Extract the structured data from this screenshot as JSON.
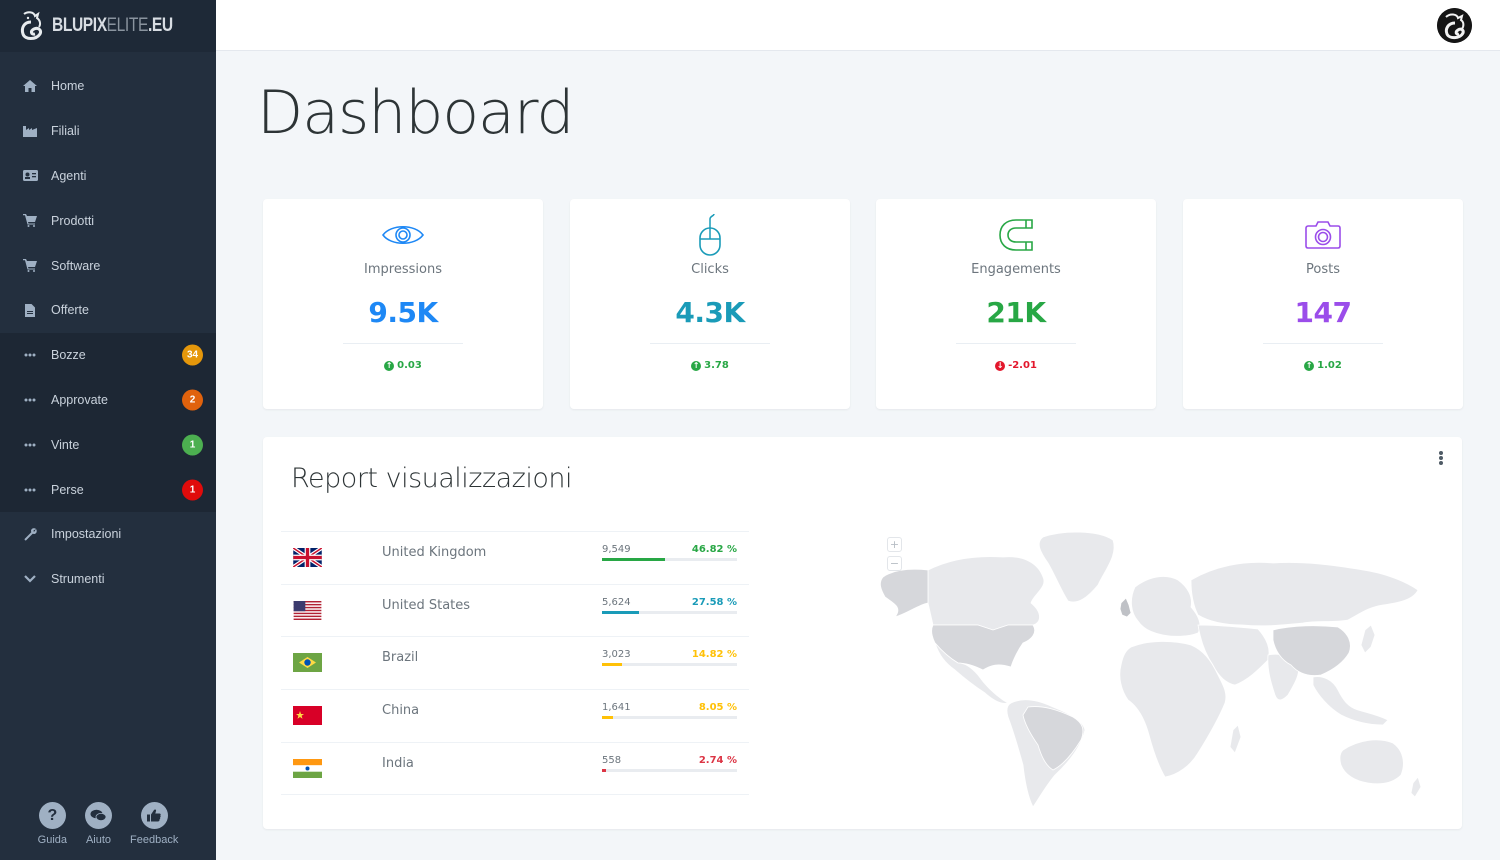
{
  "brand": {
    "name_bold": "BLUPIX",
    "name_thin": "ELITE",
    "name_tld": ".EU"
  },
  "sidebar": {
    "items": [
      {
        "label": "Home",
        "icon": "home-icon"
      },
      {
        "label": "Filiali",
        "icon": "industry-icon"
      },
      {
        "label": "Agenti",
        "icon": "id-card-icon"
      },
      {
        "label": "Prodotti",
        "icon": "cart-icon"
      },
      {
        "label": "Software",
        "icon": "cart-icon"
      },
      {
        "label": "Offerte",
        "icon": "file-icon"
      }
    ],
    "group": [
      {
        "label": "Bozze",
        "icon": "ellipsis-icon",
        "badge": "34",
        "badge_color": "#e5970b"
      },
      {
        "label": "Approvate",
        "icon": "ellipsis-icon",
        "badge": "2",
        "badge_color": "#e0620d"
      },
      {
        "label": "Vinte",
        "icon": "ellipsis-icon",
        "badge": "1",
        "badge_color": "#4caf50"
      },
      {
        "label": "Perse",
        "icon": "ellipsis-icon",
        "badge": "1",
        "badge_color": "#e00b0b"
      }
    ],
    "bottom_items": [
      {
        "label": "Impostazioni",
        "icon": "wrench-icon"
      },
      {
        "label": "Strumenti",
        "icon": "chevron-down-icon"
      }
    ],
    "footer": [
      {
        "label": "Guida",
        "icon": "question-icon"
      },
      {
        "label": "Aiuto",
        "icon": "chat-icon"
      },
      {
        "label": "Feedback",
        "icon": "thumbs-up-icon"
      }
    ]
  },
  "page": {
    "title": "Dashboard"
  },
  "stats": [
    {
      "label": "Impressions",
      "value": "9.5K",
      "delta": "0.03",
      "trend": "up",
      "color": "#1e88f5",
      "icon": "eye-icon"
    },
    {
      "label": "Clicks",
      "value": "4.3K",
      "delta": "3.78",
      "trend": "up",
      "color": "#1a9bb8",
      "icon": "mouse-icon"
    },
    {
      "label": "Engagements",
      "value": "21K",
      "delta": "-2.01",
      "trend": "down",
      "color": "#28a745",
      "icon": "magnet-icon"
    },
    {
      "label": "Posts",
      "value": "147",
      "delta": "1.02",
      "trend": "up",
      "color": "#9b4dea",
      "icon": "camera-icon"
    }
  ],
  "colors": {
    "up": "#28a745",
    "down": "#e3172c"
  },
  "report": {
    "title": "Report visualizzazioni",
    "countries": [
      {
        "name": "United Kingdom",
        "count": "9,549",
        "percent_label": "46.82 %",
        "percent": 46.82,
        "color": "#28a745",
        "flag": "gb"
      },
      {
        "name": "United States",
        "count": "5,624",
        "percent_label": "27.58 %",
        "percent": 27.58,
        "color": "#1a9bb8",
        "flag": "us"
      },
      {
        "name": "Brazil",
        "count": "3,023",
        "percent_label": "14.82 %",
        "percent": 14.82,
        "color": "#ffc107",
        "flag": "br"
      },
      {
        "name": "China",
        "count": "1,641",
        "percent_label": "8.05 %",
        "percent": 8.05,
        "color": "#ffc107",
        "flag": "cn"
      },
      {
        "name": "India",
        "count": "558",
        "percent_label": "2.74 %",
        "percent": 2.74,
        "color": "#dc3545",
        "flag": "in"
      }
    ],
    "map_zoom_in": "+",
    "map_zoom_out": "−"
  }
}
